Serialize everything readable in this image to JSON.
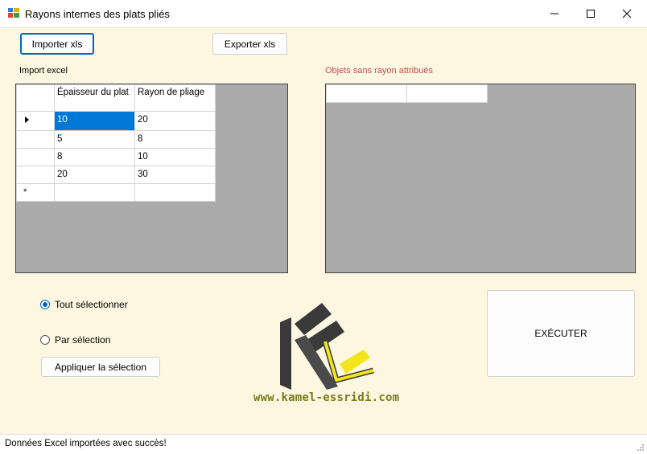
{
  "window": {
    "title": "Rayons internes des plats pliés",
    "controls": {
      "minimize": "minimize",
      "maximize": "maximize",
      "close": "close"
    }
  },
  "toolbar": {
    "import_label": "Importer xls",
    "export_label": "Exporter xls"
  },
  "import_grid": {
    "label": "Import excel",
    "columns": [
      "Épaisseur du plat",
      "Rayon de pliage"
    ],
    "rows": [
      [
        "10",
        "20"
      ],
      [
        "5",
        "8"
      ],
      [
        "8",
        "10"
      ],
      [
        "20",
        "30"
      ]
    ],
    "new_row_marker": "*",
    "current_row_marker": "▶"
  },
  "unassigned_grid": {
    "label": "Objets sans rayon attribués",
    "label_color": "#c0504d"
  },
  "selection": {
    "select_all_label": "Tout sélectionner",
    "by_selection_label": "Par sélection",
    "apply_label": "Appliquer la sélection",
    "selected": "select_all"
  },
  "execute_label": "EXÉCUTER",
  "website": "www.kamel-essridi.com",
  "status": {
    "message": "Données Excel importées avec succès!"
  },
  "colors": {
    "accent": "#0067c0",
    "selection": "#0078d7",
    "background": "#fdf7e1",
    "logo_yellow": "#f2e51a",
    "logo_dark": "#3a3a3a"
  }
}
